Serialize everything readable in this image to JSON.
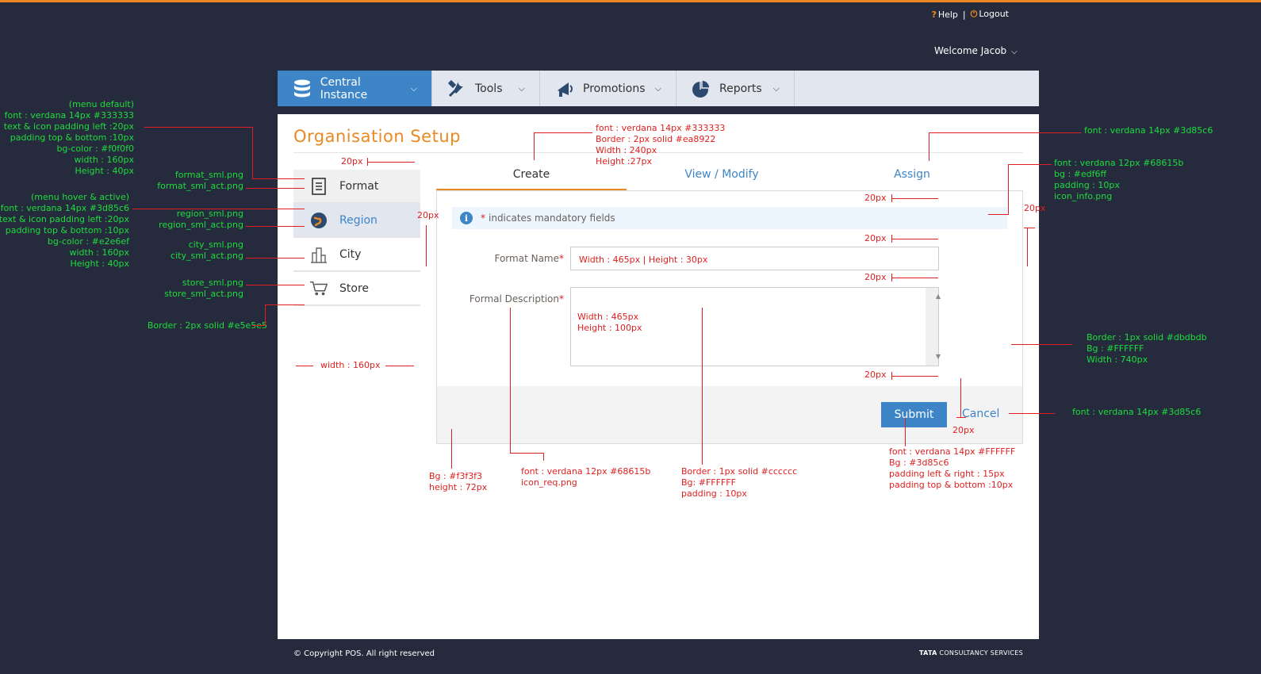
{
  "header": {
    "help": "Help",
    "separator": "|",
    "logout": "Logout",
    "welcome": "Welcome Jacob"
  },
  "nav": [
    {
      "label": "Central Instance",
      "icon": "database-icon",
      "active": true
    },
    {
      "label": "Tools",
      "icon": "tools-icon",
      "active": false
    },
    {
      "label": "Promotions",
      "icon": "megaphone-icon",
      "active": false
    },
    {
      "label": "Reports",
      "icon": "pie-chart-icon",
      "active": false
    }
  ],
  "page": {
    "title": "Organisation Setup"
  },
  "sidemenu": [
    {
      "label": "Format",
      "icon": "document-icon",
      "state": "default"
    },
    {
      "label": "Region",
      "icon": "globe-icon",
      "state": "active"
    },
    {
      "label": "City",
      "icon": "city-icon",
      "state": "normal"
    },
    {
      "label": "Store",
      "icon": "cart-icon",
      "state": "normal"
    }
  ],
  "tabs": [
    {
      "label": "Create",
      "active": true
    },
    {
      "label": "View / Modify",
      "active": false
    },
    {
      "label": "Assign",
      "active": false
    }
  ],
  "form": {
    "info_mark": "*",
    "info": "indicates mandatory fields",
    "format_name_label": "Format Name",
    "format_name_value": "Width : 465px |   Height : 30px",
    "format_desc_label": "Formal Description",
    "format_desc_value_1": "Width : 465px",
    "format_desc_value_2": "Height : 100px",
    "required_mark": "*",
    "submit": "Submit",
    "cancel": "Cancel"
  },
  "footer": {
    "copyright": "© Copyright POS. All right reserved",
    "brand_bold": "TATA",
    "brand_rest": " CONSULTANCY SERVICES"
  },
  "annotations": {
    "menu_default": [
      "(menu default)",
      "font : verdana 14px #333333",
      "text & icon padding left :20px",
      "padding top & bottom :10px",
      "bg-color : #f0f0f0",
      "width : 160px",
      "Height : 40px"
    ],
    "format_icons": [
      "format_sml.png",
      "format_sml_act.png"
    ],
    "menu_hover": [
      "(menu hover & active)",
      "font : verdana 14px #3d85c6",
      "text & icon padding left :20px",
      "padding top & bottom :10px",
      "bg-color : #e2e6ef",
      "width : 160px",
      "Height : 40px"
    ],
    "region_icons": [
      "region_sml.png",
      "region_sml_act.png"
    ],
    "city_icons": [
      "city_sml.png",
      "city_sml_act.png"
    ],
    "store_icons": [
      "store_sml.png",
      "store_sml_act.png"
    ],
    "menu_border": "Border : 2px solid #e5e5e5",
    "menu_width": "width : 160px",
    "gap_20": "20px",
    "tab_spec": [
      "font : verdana 14px  #333333",
      "Border : 2px solid #ea8922",
      "Width : 240px",
      "Height :27px"
    ],
    "tab_link_font": "font : verdana 14px  #3d85c6",
    "info_spec": [
      "font : verdana 12px  #68615b",
      "bg : #edf6ff",
      "padding : 10px",
      "icon_info.png"
    ],
    "box_spec": [
      "Border : 1px solid #dbdbdb",
      "Bg : #FFFFFF",
      "Width : 740px"
    ],
    "cancel_font": "font : verdana 14px  #3d85c6",
    "submit_spec": [
      "font : verdana 14px  #FFFFFF",
      "Bg : #3d85c6",
      "padding left & right : 15px",
      "padding top & bottom :10px"
    ],
    "footer_bg": [
      "Bg : #f3f3f3",
      "height : 72px"
    ],
    "label_spec": [
      "font : verdana 12px  #68615b",
      "icon_req.png"
    ],
    "textarea_spec": [
      "Border : 1px solid #cccccc",
      "Bg: #FFFFFF",
      "padding : 10px"
    ]
  }
}
